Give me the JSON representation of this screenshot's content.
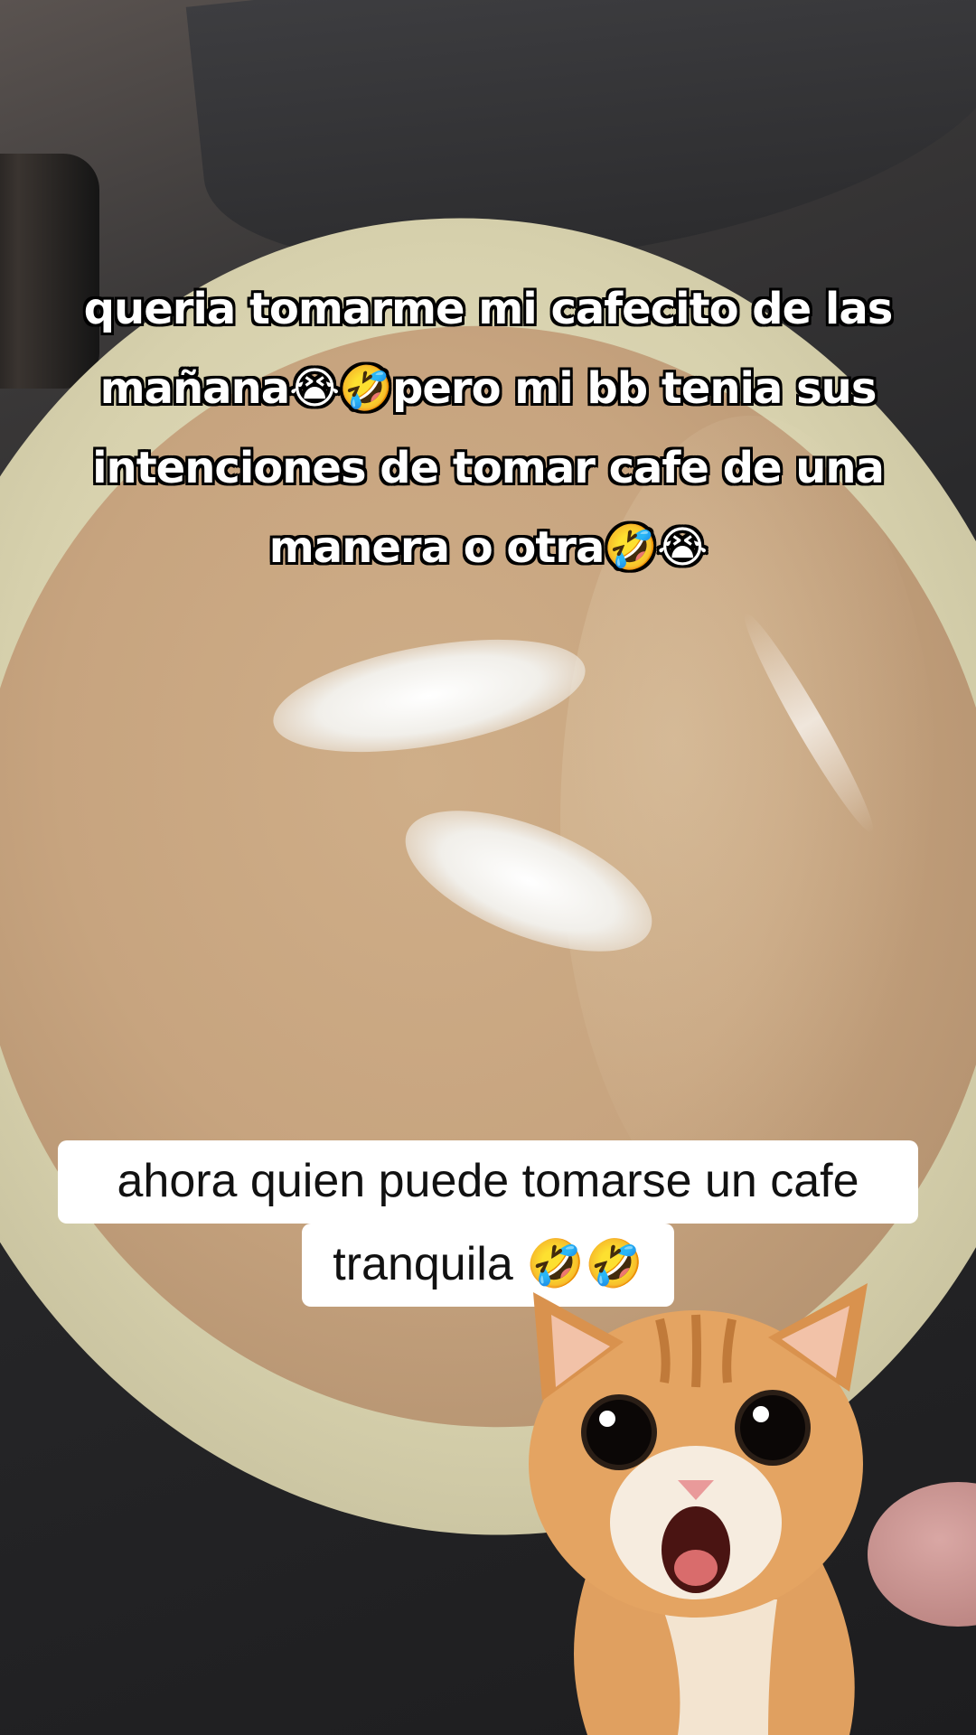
{
  "caption_top": {
    "lines": [
      "queria tomarme mi cafecito de las",
      "mañana😭🤣pero mi bb tenia sus",
      "intenciones de tomar cafe de una",
      "manera o otra🤣😭"
    ]
  },
  "caption_bottom": {
    "line1": "ahora quien puede tomarse un cafe",
    "line2": "tranquila 🤣🤣"
  }
}
